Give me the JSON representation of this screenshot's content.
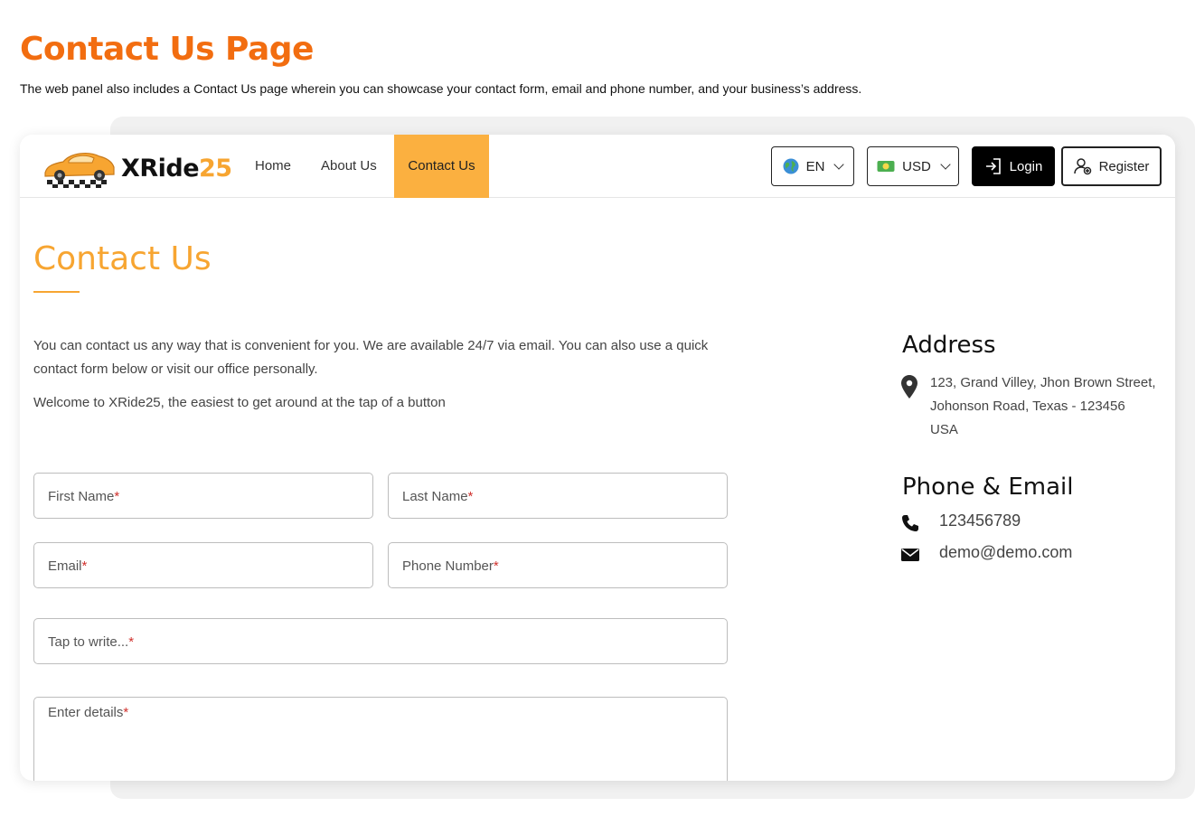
{
  "page": {
    "title": "Contact Us Page",
    "description": "The web panel also includes a Contact Us page wherein you can showcase your contact form, email and phone number, and your business’s address."
  },
  "brand": {
    "name_main": "XRide",
    "name_accent": "25",
    "accent_color": "#f7a531"
  },
  "nav": {
    "home": "Home",
    "about": "About Us",
    "contact": "Contact Us"
  },
  "header_controls": {
    "language": "EN",
    "currency": "USD",
    "login": "Login",
    "register": "Register"
  },
  "contact": {
    "heading": "Contact Us",
    "intro": "You can contact us any way that is convenient for you. We are available 24/7 via email. You can also use a quick contact form below or visit our office personally.",
    "welcome": "Welcome to XRide25, the easiest to get around at the tap of a button"
  },
  "form": {
    "first_name": "First Name",
    "last_name": "Last Name",
    "email": "Email",
    "phone": "Phone Number",
    "subject": "Tap to write...",
    "details": "Enter details",
    "required_mark": "*"
  },
  "address": {
    "title": "Address",
    "line1": "123, Grand Villey, Jhon Brown Street,",
    "line2": "Johonson Road, Texas - 123456",
    "line3": "USA"
  },
  "phone_email": {
    "title": "Phone & Email",
    "phone": "123456789",
    "email": "demo@demo.com"
  },
  "icons": [
    "car-logo-icon",
    "globe-icon",
    "money-icon",
    "chevron-down-icon",
    "login-icon",
    "user-add-icon",
    "location-pin-icon",
    "phone-icon",
    "envelope-icon"
  ]
}
